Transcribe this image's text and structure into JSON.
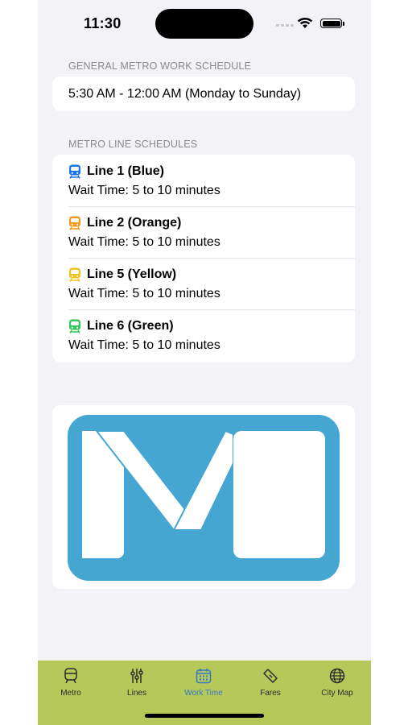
{
  "status": {
    "time": "11:30"
  },
  "sections": {
    "general_header": "GENERAL METRO WORK SCHEDULE",
    "general_schedule": "5:30 AM - 12:00 AM (Monday to Sunday)",
    "lines_header": "METRO LINE SCHEDULES"
  },
  "lines": [
    {
      "name": "Line 1 (Blue)",
      "wait": "Wait Time: 5 to 10 minutes",
      "color": "#1a73e8"
    },
    {
      "name": "Line 2 (Orange)",
      "wait": "Wait Time: 5 to 10 minutes",
      "color": "#f29a1b"
    },
    {
      "name": "Line 5 (Yellow)",
      "wait": "Wait Time: 5 to 10 minutes",
      "color": "#f2c21b"
    },
    {
      "name": "Line 6 (Green)",
      "wait": "Wait Time: 5 to 10 minutes",
      "color": "#34c759"
    }
  ],
  "logo": {
    "background": "#46a6d2",
    "foreground": "#ffffff",
    "icon": "metro-logo"
  },
  "tabs": [
    {
      "label": "Metro",
      "icon": "train-outline-icon",
      "active": false
    },
    {
      "label": "Lines",
      "icon": "lines-icon",
      "active": false
    },
    {
      "label": "Work Time",
      "icon": "calendar-icon",
      "active": true
    },
    {
      "label": "Fares",
      "icon": "ticket-icon",
      "active": false
    },
    {
      "label": "City Map",
      "icon": "globe-icon",
      "active": false
    }
  ],
  "colors": {
    "tabbar": "#b7c85b",
    "active_tab": "#3478c6",
    "background": "#f2f2f7"
  }
}
